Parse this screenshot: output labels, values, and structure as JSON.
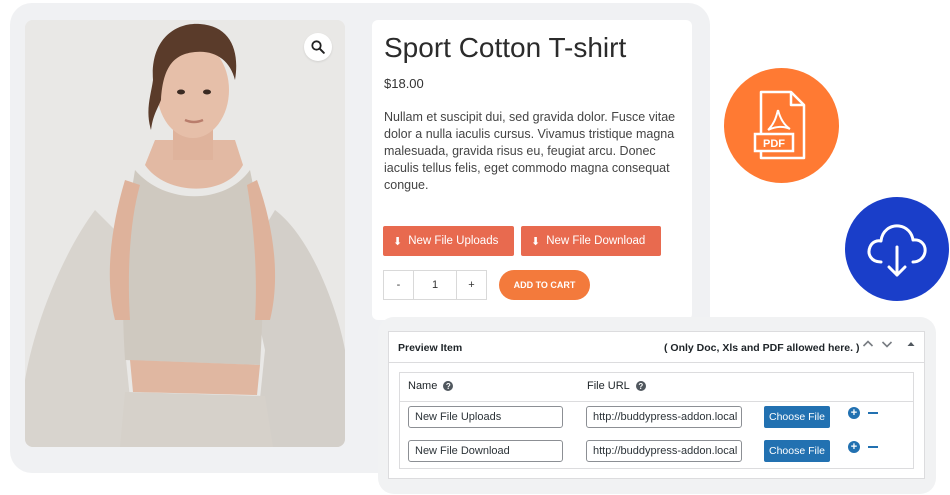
{
  "product": {
    "title": "Sport Cotton T-shirt",
    "price": "$18.00",
    "description": "Nullam et suscipit dui, sed gravida dolor. Fusce vitae dolor a nulla iaculis cursus. Vivamus tristique magna malesuada, gravida risus eu, feugiat arcu. Donec iaculis tellus felis, eget commodo magna consequat congue.",
    "file_buttons": [
      "New File Uploads",
      "New File Download"
    ],
    "quantity": {
      "minus": "-",
      "value": "1",
      "plus": "+"
    },
    "add_to_cart": "ADD TO CART"
  },
  "badges": {
    "pdf_label": "PDF"
  },
  "preview_panel": {
    "title": "Preview Item",
    "note": "( Only Doc, Xls and PDF allowed here. )",
    "columns": {
      "name": "Name",
      "file_url": "File URL"
    },
    "rows": [
      {
        "name": "New File Uploads",
        "url": "http://buddypress-addon.local",
        "button": "Choose File"
      },
      {
        "name": "New File Download",
        "url": "http://buddypress-addon.local",
        "button": "Choose File"
      }
    ]
  },
  "colors": {
    "file_button": "#e86a4f",
    "add_to_cart": "#f37a3c",
    "pdf_circle": "#ff7a33",
    "cloud_circle": "#1a3ec9",
    "wp_blue": "#2271b1"
  }
}
